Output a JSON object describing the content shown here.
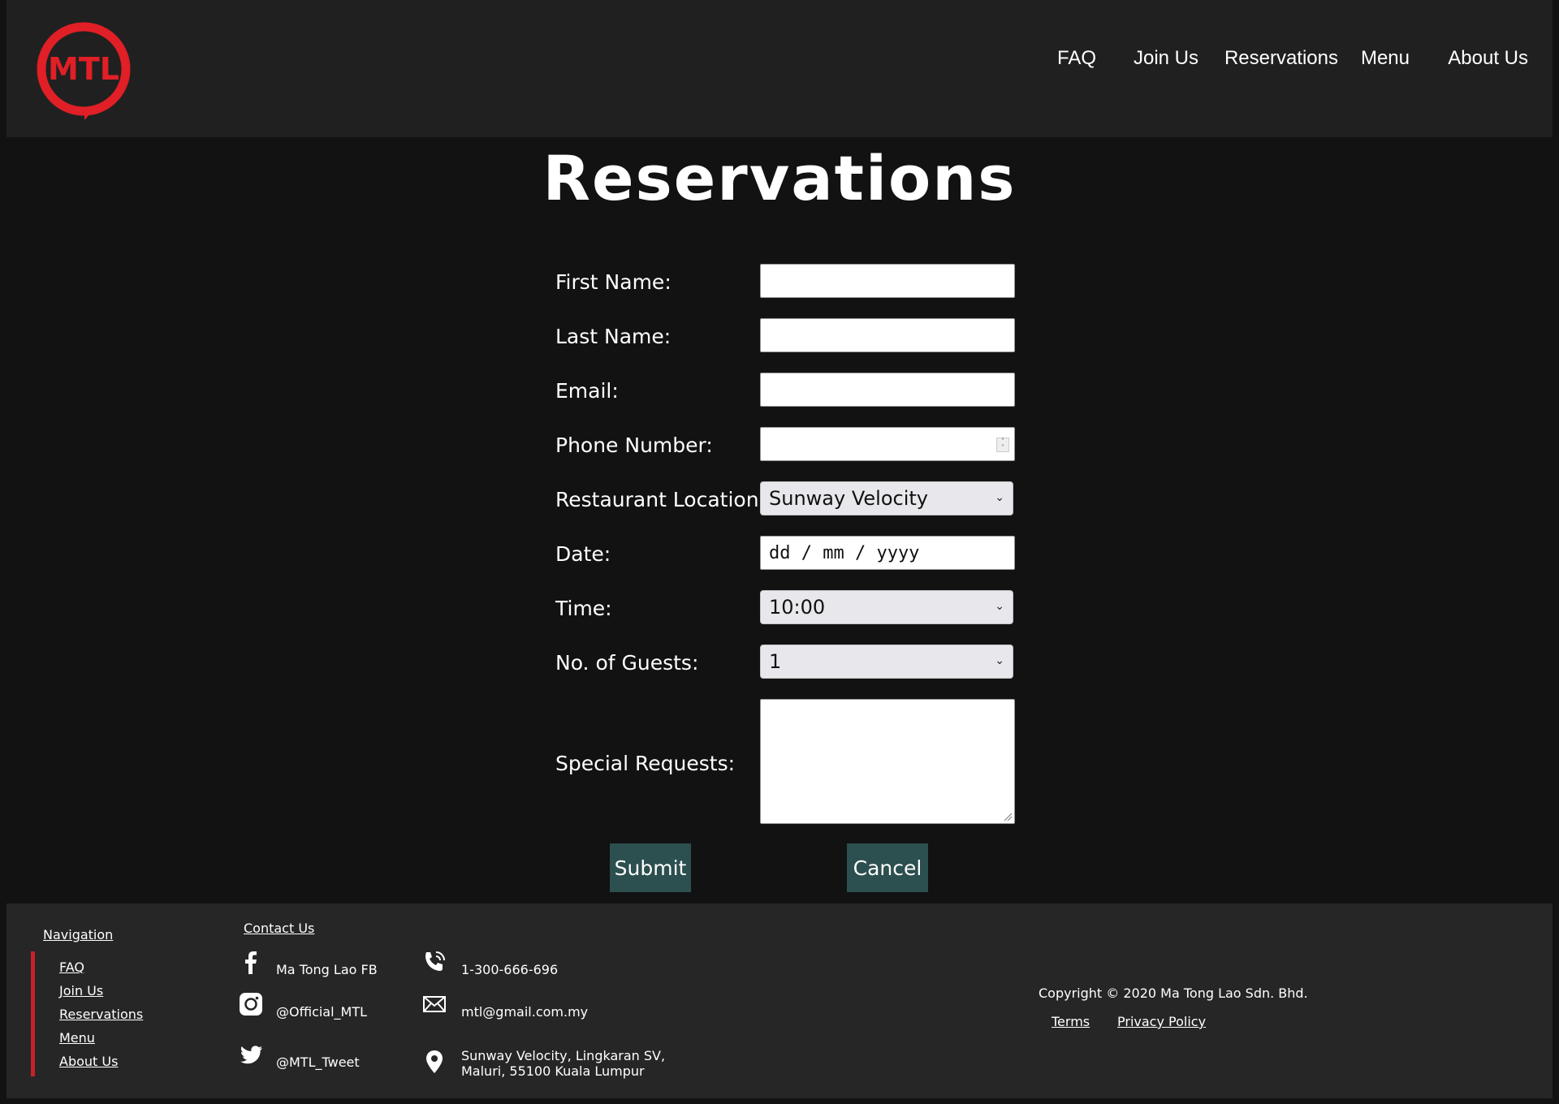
{
  "brand": {
    "logo_text": "MTL",
    "logo_color": "#e01f26"
  },
  "nav": {
    "items": [
      {
        "label": "FAQ"
      },
      {
        "label": "Join Us"
      },
      {
        "label": "Reservations"
      },
      {
        "label": "Menu"
      },
      {
        "label": "About Us"
      }
    ]
  },
  "page": {
    "title": "Reservations"
  },
  "form": {
    "first_name_label": "First Name:",
    "last_name_label": "Last Name:",
    "email_label": "Email:",
    "phone_label": "Phone Number:",
    "location_label": "Restaurant Location:",
    "location_value": "Sunway Velocity",
    "date_label": "Date:",
    "date_placeholder": "dd / mm / yyyy",
    "time_label": "Time:",
    "time_value": "10:00",
    "guests_label": "No. of Guests:",
    "guests_value": "1",
    "requests_label": "Special Requests:",
    "submit_label": "Submit",
    "cancel_label": "Cancel",
    "button_color": "#2c4f4f"
  },
  "footer": {
    "nav_heading": "Navigation",
    "nav_links": [
      "FAQ",
      "Join Us",
      "Reservations",
      "Menu",
      "About Us"
    ],
    "contact_heading": "Contact Us",
    "facebook": "Ma Tong Lao FB",
    "instagram": "@Official_MTL",
    "twitter": "@MTL_Tweet",
    "phone": "1-300-666-696",
    "email": "mtl@gmail.com.my",
    "address_line1": "Sunway Velocity, Lingkaran SV,",
    "address_line2": "Maluri, 55100 Kuala Lumpur",
    "copyright": "Copyright © 2020 Ma Tong Lao Sdn. Bhd.",
    "terms": "Terms",
    "privacy": "Privacy Policy",
    "accent_color": "#c8202a"
  }
}
